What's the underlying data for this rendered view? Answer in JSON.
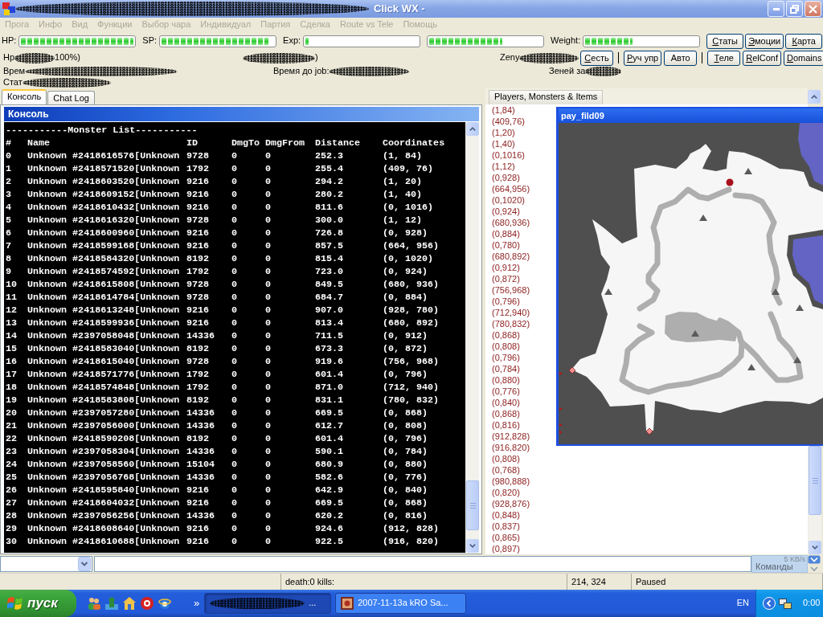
{
  "window": {
    "title": "Click WX -",
    "redacted": true
  },
  "menu": [
    {
      "label": "Прога",
      "disabled": true
    },
    {
      "label": "Инфо",
      "disabled": true
    },
    {
      "label": "Вид",
      "disabled": true
    },
    {
      "label": "Функции",
      "disabled": true
    },
    {
      "label": "Выбор чара",
      "disabled": true
    },
    {
      "label": "Индивидуал",
      "disabled": true
    },
    {
      "label": "Партия",
      "disabled": true
    },
    {
      "label": "Сделка",
      "disabled": true
    },
    {
      "label": "Route vs Tele",
      "disabled": true
    },
    {
      "label": "Помощь",
      "disabled": true
    }
  ],
  "gauges": [
    {
      "label": "HP:",
      "level": 1
    },
    {
      "label": "SP:",
      "level": 0.95
    },
    {
      "label": "Exp:",
      "level": 0.03
    },
    {
      "level": 0.65
    },
    {
      "label": "Weight:",
      "level": 0.42
    }
  ],
  "top_buttons": [
    {
      "label": "Статы",
      "mnemonic": true
    },
    {
      "label": "Эмоции",
      "mnemonic": true
    },
    {
      "label": "Карта",
      "mnemonic": true
    }
  ],
  "info": {
    "hp": {
      "label": "Hp",
      "redacted": true,
      "value": "100%)"
    },
    "sp": {
      "redacted": true,
      "value": ")"
    },
    "zeny": {
      "label": "Zeny",
      "redacted": true
    },
    "time": {
      "label": "Врем",
      "redacted": true
    },
    "job_time": {
      "label": "Время до job:",
      "redacted": true
    },
    "zeny_rate": {
      "label": "Зеней за",
      "redacted": true
    },
    "stats": {
      "label": "Стат",
      "redacted": true
    }
  },
  "action_buttons": [
    {
      "kind": "button",
      "label": "Сесть",
      "mnemonic": true
    },
    {
      "kind": "separator"
    },
    {
      "kind": "button",
      "label": "Руч упр",
      "mnemonic": true
    },
    {
      "kind": "button",
      "label": "Авто",
      "mnemonic": false
    },
    {
      "kind": "separator"
    },
    {
      "kind": "button",
      "label": "Теле",
      "mnemonic": true
    },
    {
      "kind": "button",
      "label": "RelConf",
      "mnemonic": true
    },
    {
      "kind": "button",
      "label": "Domains",
      "mnemonic": true
    }
  ],
  "console_tabs": [
    {
      "label": "Консоль",
      "selected": true
    },
    {
      "label": "Chat Log",
      "selected": false
    }
  ],
  "console": {
    "title": "Консоль",
    "heading": "-----------Monster List-----------",
    "columns": [
      "#",
      "Name",
      "ID",
      "DmgTo",
      "DmgFrom",
      "Distance",
      "Coordinates"
    ],
    "rows": [
      [
        "0",
        "Unknown #2418616576[Unknown",
        "9728",
        "0",
        "0",
        "252.3",
        "(1, 84)"
      ],
      [
        "1",
        "Unknown #2418571520[Unknown",
        "1792",
        "0",
        "0",
        "255.4",
        "(409, 76)"
      ],
      [
        "2",
        "Unknown #2418603520[Unknown",
        "9216",
        "0",
        "0",
        "294.2",
        "(1, 20)"
      ],
      [
        "3",
        "Unknown #2418609152[Unknown",
        "9216",
        "0",
        "0",
        "280.2",
        "(1, 40)"
      ],
      [
        "4",
        "Unknown #2418610432[Unknown",
        "9216",
        "0",
        "0",
        "811.6",
        "(0, 1016)"
      ],
      [
        "5",
        "Unknown #2418616320[Unknown",
        "9728",
        "0",
        "0",
        "300.0",
        "(1, 12)"
      ],
      [
        "6",
        "Unknown #2418600960[Unknown",
        "9216",
        "0",
        "0",
        "726.8",
        "(0, 928)"
      ],
      [
        "7",
        "Unknown #2418599168[Unknown",
        "9216",
        "0",
        "0",
        "857.5",
        "(664, 956)"
      ],
      [
        "8",
        "Unknown #2418584320[Unknown",
        "8192",
        "0",
        "0",
        "815.4",
        "(0, 1020)"
      ],
      [
        "9",
        "Unknown #2418574592[Unknown",
        "1792",
        "0",
        "0",
        "723.0",
        "(0, 924)"
      ],
      [
        "10",
        "Unknown #2418615808[Unknown",
        "9728",
        "0",
        "0",
        "849.5",
        "(680, 936)"
      ],
      [
        "11",
        "Unknown #2418614784[Unknown",
        "9728",
        "0",
        "0",
        "684.7",
        "(0, 884)"
      ],
      [
        "12",
        "Unknown #2418613248[Unknown",
        "9216",
        "0",
        "0",
        "907.0",
        "(928, 780)"
      ],
      [
        "13",
        "Unknown #2418599936[Unknown",
        "9216",
        "0",
        "0",
        "813.4",
        "(680, 892)"
      ],
      [
        "14",
        "Unknown #2397058048[Unknown",
        "14336",
        "0",
        "0",
        "711.5",
        "(0, 912)"
      ],
      [
        "15",
        "Unknown #2418583040[Unknown",
        "8192",
        "0",
        "0",
        "673.3",
        "(0, 872)"
      ],
      [
        "16",
        "Unknown #2418615040[Unknown",
        "9728",
        "0",
        "0",
        "919.6",
        "(756, 968)"
      ],
      [
        "17",
        "Unknown #2418571776[Unknown",
        "1792",
        "0",
        "0",
        "601.4",
        "(0, 796)"
      ],
      [
        "18",
        "Unknown #2418574848[Unknown",
        "1792",
        "0",
        "0",
        "871.0",
        "(712, 940)"
      ],
      [
        "19",
        "Unknown #2418583808[Unknown",
        "8192",
        "0",
        "0",
        "831.1",
        "(780, 832)"
      ],
      [
        "20",
        "Unknown #2397057280[Unknown",
        "14336",
        "0",
        "0",
        "669.5",
        "(0, 868)"
      ],
      [
        "21",
        "Unknown #2397056000[Unknown",
        "14336",
        "0",
        "0",
        "612.7",
        "(0, 808)"
      ],
      [
        "22",
        "Unknown #2418590208[Unknown",
        "8192",
        "0",
        "0",
        "601.4",
        "(0, 796)"
      ],
      [
        "23",
        "Unknown #2397058304[Unknown",
        "14336",
        "0",
        "0",
        "590.1",
        "(0, 784)"
      ],
      [
        "24",
        "Unknown #2397058560[Unknown",
        "15104",
        "0",
        "0",
        "680.9",
        "(0, 880)"
      ],
      [
        "25",
        "Unknown #2397056768[Unknown",
        "14336",
        "0",
        "0",
        "582.6",
        "(0, 776)"
      ],
      [
        "26",
        "Unknown #2418595840[Unknown",
        "9216",
        "0",
        "0",
        "642.9",
        "(0, 840)"
      ],
      [
        "27",
        "Unknown #2418604032[Unknown",
        "9216",
        "0",
        "0",
        "669.5",
        "(0, 868)"
      ],
      [
        "28",
        "Unknown #2397056256[Unknown",
        "14336",
        "0",
        "0",
        "620.2",
        "(0, 816)"
      ],
      [
        "29",
        "Unknown #2418608640[Unknown",
        "9216",
        "0",
        "0",
        "924.6",
        "(912, 828)"
      ],
      [
        "30",
        "Unknown #2418610688[Unknown",
        "9216",
        "0",
        "0",
        "922.5",
        "(916, 820)"
      ]
    ]
  },
  "side_tabs": [
    {
      "label": "Players, Monsters & Items",
      "selected": true
    }
  ],
  "entity_list": [
    "(1,84)",
    "(409,76)",
    "(1,20)",
    "(1,40)",
    "(0,1016)",
    "(1,12)",
    "(0,928)",
    "(664,956)",
    "(0,1020)",
    "(0,924)",
    "(680,936)",
    "(0,884)",
    "(0,780)",
    "(680,892)",
    "(0,912)",
    "(0,872)",
    "(756,968)",
    "(0,796)",
    "(712,940)",
    "(780,832)",
    "(0,868)",
    "(0,808)",
    "(0,796)",
    "(0,784)",
    "(0,880)",
    "(0,776)",
    "(0,840)",
    "(0,868)",
    "(0,816)",
    "(912,828)",
    "(916,820)",
    "(0,808)",
    "(0,768)",
    "(980,888)",
    "(0,820)",
    "(928,876)",
    "(0,848)",
    "(0,837)",
    "(0,865)",
    "(0,897)"
  ],
  "map_window": {
    "title": "pay_fild09"
  },
  "command_bar": {
    "button": "Команды",
    "speed": "5 KB/s"
  },
  "status_bar": {
    "stats": "death:0 kills:",
    "position": "214, 324",
    "state": "Paused"
  },
  "taskbar": {
    "start": "пуск",
    "overflow": "»",
    "tasks": [
      {
        "label": "...",
        "selected": true,
        "redacted": true
      },
      {
        "label": "2007-11-13a kRO Sa...",
        "selected": false
      }
    ],
    "language": "EN",
    "clock": "0:00"
  }
}
